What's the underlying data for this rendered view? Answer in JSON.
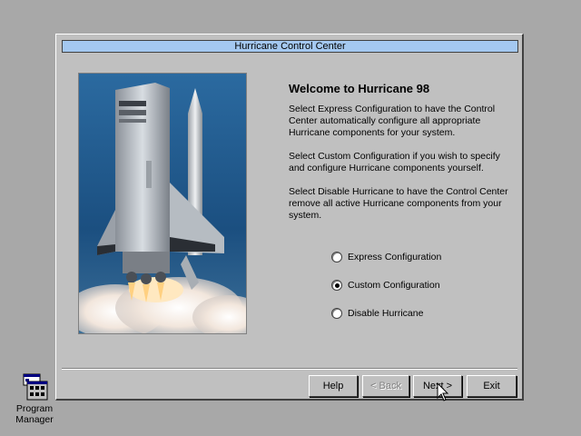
{
  "window": {
    "title": "Hurricane Control Center"
  },
  "content": {
    "heading": "Welcome to Hurricane 98",
    "paragraphs": [
      "Select Express Configuration to have the Control Center automatically configure all appropriate Hurricane components for your system.",
      "Select Custom Configuration if you wish to specify and configure Hurricane components yourself.",
      "Select Disable Hurricane to have the Control Center remove all active Hurricane components from your system."
    ],
    "options": [
      {
        "label": "Express Configuration",
        "checked": false
      },
      {
        "label": "Custom Configuration",
        "checked": true
      },
      {
        "label": "Disable Hurricane",
        "checked": false
      }
    ]
  },
  "buttons": {
    "help": "Help",
    "back": "< Back",
    "next": "Next >",
    "exit": "Exit"
  },
  "desktop": {
    "icon_label_line1": "Program",
    "icon_label_line2": "Manager"
  },
  "colors": {
    "desktop": "#a8a8a8",
    "window": "#c0c0c0",
    "titlebar": "#a4c8f0",
    "hero_sky": "#1e5a8c"
  }
}
